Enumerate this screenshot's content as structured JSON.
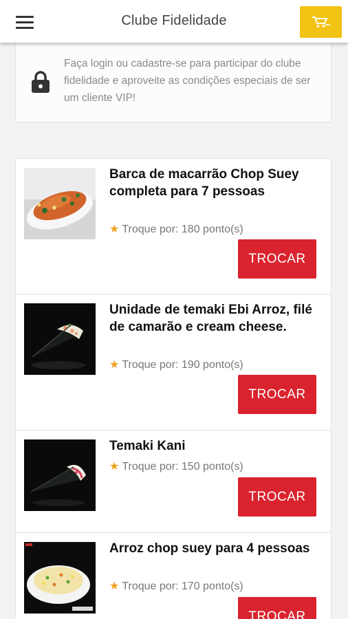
{
  "header": {
    "title": "Clube Fidelidade",
    "menu_icon": "hamburger-menu-icon",
    "cart_icon": "shopping-cart-icon",
    "cart_color": "#f2c313"
  },
  "notice": {
    "icon": "lock-icon",
    "text": "Faça login ou cadastre-se para participar do clube fidelidade e aproveite as condições especiais de ser um cliente VIP!"
  },
  "accent_color": "#d9232e",
  "products": [
    {
      "name": "Barca de macarrão Chop Suey completa para 7 pessoas",
      "points": "Troque por: 180 ponto(s)",
      "button": "TROCAR"
    },
    {
      "name": "Unidade de temaki Ebi Arroz, filé de camarão e cream cheese.",
      "points": "Troque por: 190 ponto(s)",
      "button": "TROCAR"
    },
    {
      "name": "Temaki Kani",
      "points": "Troque por: 150 ponto(s)",
      "button": "TROCAR"
    },
    {
      "name": "Arroz chop suey para 4 pessoas",
      "points": "Troque por: 170 ponto(s)",
      "button": "TROCAR"
    }
  ]
}
